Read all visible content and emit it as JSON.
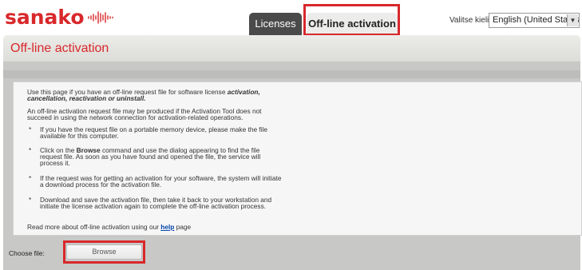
{
  "brand": {
    "logo_text": "sanako",
    "color": "#d8282b"
  },
  "tabs": [
    {
      "label": "Licenses",
      "active": false
    },
    {
      "label": "Off-line activation",
      "active": true
    }
  ],
  "language": {
    "label": "Valitse kieli",
    "selected": "English (United States)"
  },
  "page": {
    "title": "Off-line activation"
  },
  "content": {
    "intro_1": "Use this page if you have an off-line request file for software license",
    "intro_1_bold": "activation,",
    "intro_2_bold": "cancellation, reactivation or uninstall.",
    "para2_line1": "An off-line activation request file may be produced if the Activation Tool does not",
    "para2_line2": "succeed in using the network connection for activation-related operations.",
    "bullet_marker": "*",
    "b1_line1": "If you have the request file on a portable memory device, please make the file",
    "b1_line2": "available for this computer.",
    "b2_pre": "Click on the",
    "b2_bold": "Browse",
    "b2_post": "command and use the dialog appearing to find the file",
    "b2_line2": "request file. As soon as you have found and opened the file, the service will",
    "b2_line3": "process it.",
    "b3_line1": "If the request was for getting an activation for your software, the system will initiate",
    "b3_line2": "a download process for the activation file.",
    "b4_line1": "Download and save the activation file, then take it back to your workstation and",
    "b4_line2": "initiate the license activation again to complete the off-line activation process.",
    "read_more_pre": "Read more about off-line activation using our",
    "help_link": "help",
    "read_more_post": "page"
  },
  "file_chooser": {
    "label": "Choose file:",
    "button": "Browse"
  },
  "colors": {
    "accent": "#d8282b",
    "dark_tab": "#4a4a4a",
    "highlight": "#d8282b"
  }
}
